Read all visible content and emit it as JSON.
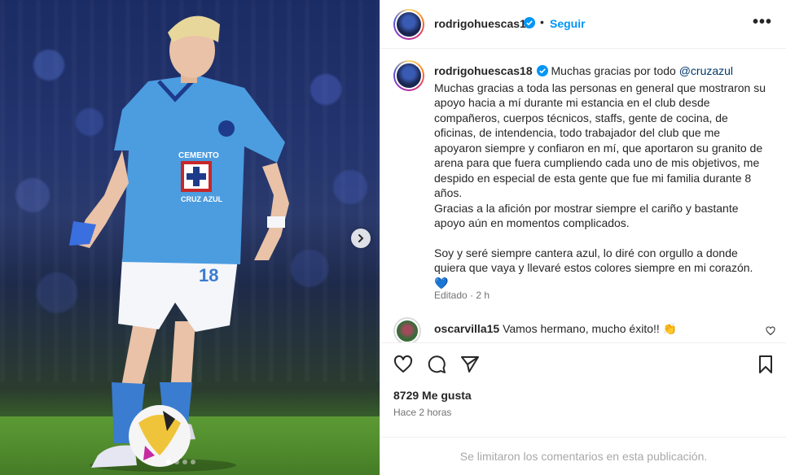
{
  "post": {
    "username": "rodrigohuescas18",
    "follow_label": "Seguir",
    "more_label": "•••",
    "caption": {
      "username": "rodrigohuescas18",
      "lead": "Muchas gracias por todo",
      "mention": "@cruzazul",
      "lines": [
        "Muchas gracias a toda las personas en general que mostraron su apoyo hacia a mí durante mi estancia en el club desde compañeros, cuerpos técnicos, staffs, gente de cocina, de oficinas, de intendencia, todo trabajador del club que me apoyaron siempre y confiaron en mí, que aportaron su granito de arena para que fuera cumpliendo cada uno de mis objetivos, me despido en especial de esta gente que fue mi familia durante 8 años.",
        "Gracias a la afición por mostrar siempre el cariño y bastante apoyo aún en momentos complicados.",
        "Soy y seré siempre cantera azul, lo diré con orgullo a donde quiera que vaya y llevaré estos colores siempre en mi corazón."
      ],
      "emoji": "💙",
      "edited": "Editado · 2 h"
    },
    "comment": {
      "username": "oscarvilla15",
      "text": "Vamos hermano, mucho éxito!!",
      "emoji": "👏"
    },
    "likes": "8729 Me gusta",
    "time_ago": "Hace 2 horas",
    "comments_limited": "Se limitaron los comentarios en esta publicación."
  },
  "carousel": {
    "next_icon": "chevron-right-icon",
    "dot_count": 4,
    "active_dot": 1
  },
  "icons": {
    "like": "heart-icon",
    "comment": "comment-icon",
    "share": "paper-plane-icon",
    "save": "bookmark-icon",
    "verified": "verified-badge-icon"
  },
  "colors": {
    "link": "#0095f6",
    "verified": "#0095f6",
    "secondary_text": "#737373"
  }
}
